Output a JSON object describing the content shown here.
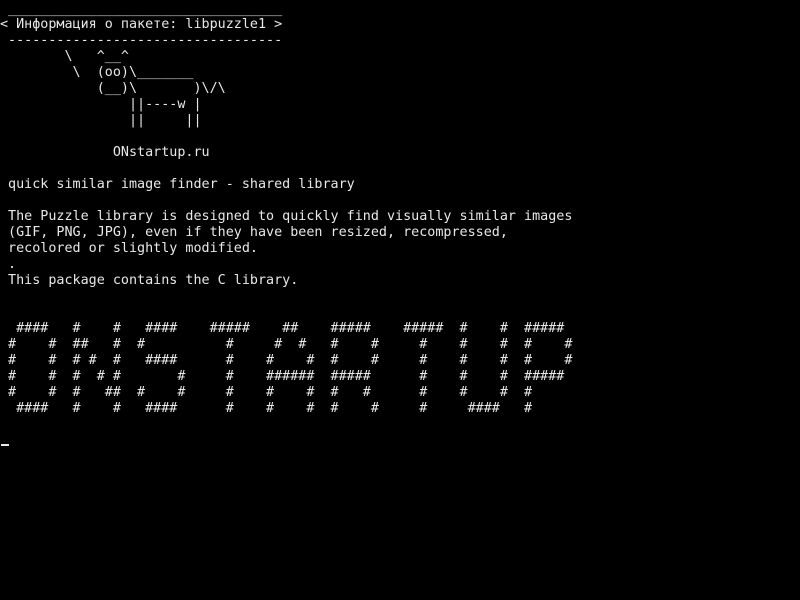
{
  "colors": {
    "background": "#000000",
    "foreground": "#e8e8e8"
  },
  "cowsay": {
    "top_border": " __________________________________",
    "message": "< Информация о пакете: libpuzzle1 >",
    "bottom_border": " ----------------------------------",
    "cow_line_1": "        \\   ^__^",
    "cow_line_2": "         \\  (oo)\\_______",
    "cow_line_3": "            (__)\\       )\\/\\",
    "cow_line_4": "                ||----w |",
    "cow_line_5": "                ||     ||",
    "site": "              ONstartup.ru"
  },
  "package": {
    "summary": " quick similar image finder - shared library",
    "description_line_1": " The Puzzle library is designed to quickly find visually similar images",
    "description_line_2": " (GIF, PNG, JPG), even if they have been resized, recompressed,",
    "description_line_3": " recolored or slightly modified.",
    "description_dot": " .",
    "description_line_4": " This package contains the C library."
  },
  "banner": {
    "line_1": "  ####   #    #   ####    #####    ##    #####    #####  #    #  #####",
    "line_2": " #    #  ##   #  #          #     #  #   #    #     #    #    #  #    #",
    "line_3": " #    #  # #  #   ####      #    #    #  #    #     #    #    #  #    #",
    "line_4": " #    #  #  # #       #     #    ######  #####      #    #    #  #####",
    "line_5": " #    #  #   ##  #    #     #    #    #  #   #      #    #    #  #",
    "line_6": "  ####   #    #   ####      #    #    #  #    #     #     ####   #"
  }
}
